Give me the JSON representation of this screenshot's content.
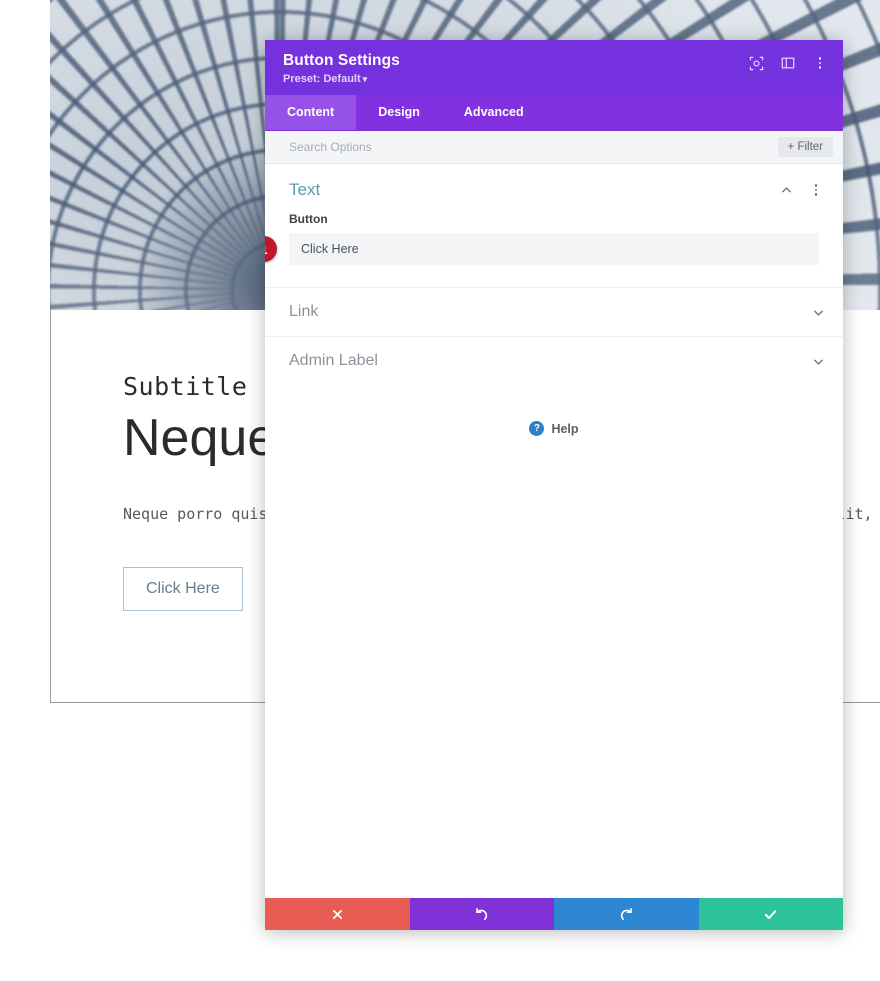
{
  "page": {
    "subtitle": "Subtitle",
    "headline": "Neque porro quisquam",
    "body": "Neque porro quisquam est qui dolorem ipsum quia dolor sit amet, consectetur, velit, sed quia non numquam eius modi tempora incidunt ut labore.",
    "cta_label": "Click Here"
  },
  "modal": {
    "title": "Button Settings",
    "preset": "Preset: Default",
    "preset_caret": "▾",
    "icons": {
      "responsive": "responsive-view-icon",
      "layout": "layout-panel-icon",
      "menu": "more-options-icon"
    },
    "tabs": [
      {
        "label": "Content",
        "active": true
      },
      {
        "label": "Design",
        "active": false
      },
      {
        "label": "Advanced",
        "active": false
      }
    ],
    "search": {
      "placeholder": "Search Options",
      "value": "",
      "filter_label": "+ Filter"
    },
    "sections": {
      "text": {
        "title": "Text",
        "collapse_icon": "chevron-up-icon",
        "menu_icon": "more-options-icon",
        "field": {
          "label": "Button",
          "value": "Click Here",
          "badge": "1"
        }
      },
      "collapsed": [
        {
          "title": "Link",
          "icon": "chevron-down-icon"
        },
        {
          "title": "Admin Label",
          "icon": "chevron-down-icon"
        }
      ]
    },
    "help": {
      "label": "Help",
      "icon": "question-mark-icon"
    },
    "footer": [
      {
        "name": "cancel-button",
        "icon": "close-icon",
        "color": "#e85c54"
      },
      {
        "name": "undo-button",
        "icon": "undo-icon",
        "color": "#8031d8"
      },
      {
        "name": "redo-button",
        "icon": "redo-icon",
        "color": "#2d86d2"
      },
      {
        "name": "save-button",
        "icon": "check-icon",
        "color": "#2dc39a"
      }
    ]
  },
  "colors": {
    "header_purple": "#7531dd",
    "tabs_purple": "#8231e0",
    "tab_active": "#9652e8",
    "section_title": "#5b9bb5",
    "badge_red": "#c0152a"
  }
}
